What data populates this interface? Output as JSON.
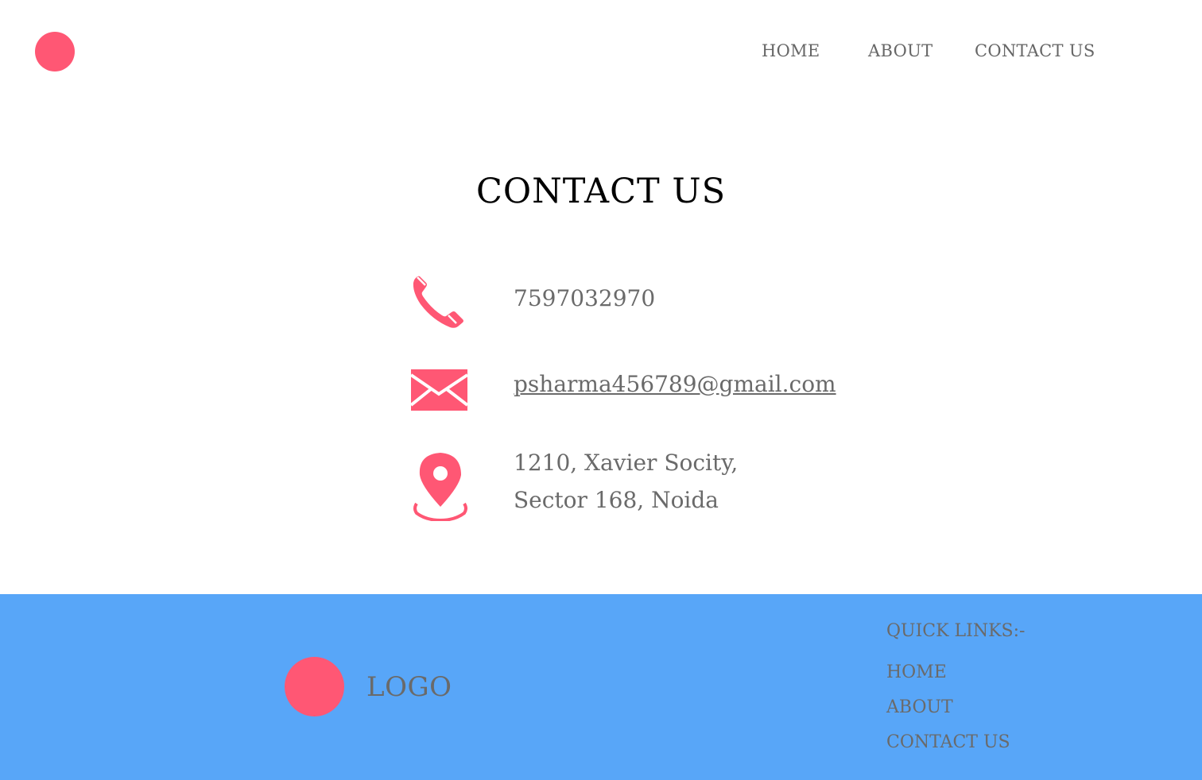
{
  "header": {
    "nav": {
      "home": "HOME",
      "about": "ABOUT",
      "contact": "CONTACT US"
    }
  },
  "main": {
    "title": "CONTACT US",
    "phone": {
      "icon": "phone-icon",
      "value": "7597032970"
    },
    "email": {
      "icon": "envelope-icon",
      "value": "psharma456789@gmail.com"
    },
    "address": {
      "icon": "location-pin-icon",
      "line1": "1210, Xavier Socity,",
      "line2": "Sector 168, Noida"
    }
  },
  "footer": {
    "logo_text": "LOGO",
    "quick_links_title": "QUICK LINKS:-",
    "quick_links": {
      "home": "HOME",
      "about": "ABOUT",
      "contact": "CONTACT US"
    }
  },
  "colors": {
    "accent": "#ff5774",
    "footer_bg": "#58a6f8",
    "text": "#6a6a6a"
  }
}
